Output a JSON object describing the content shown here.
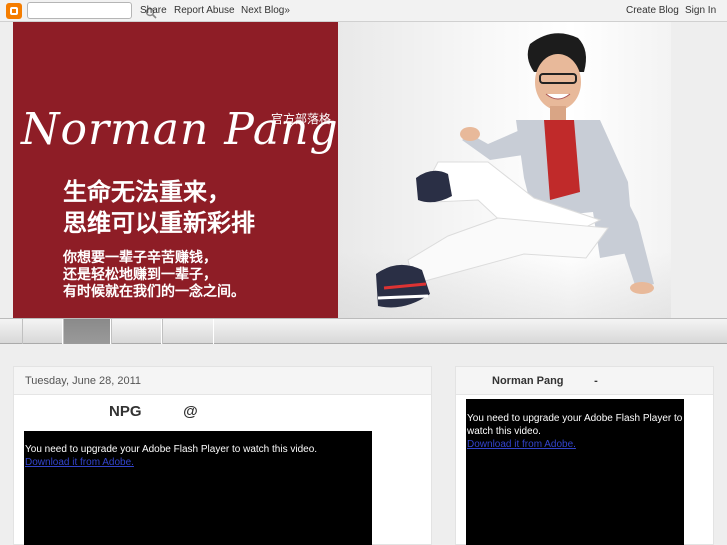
{
  "navbar": {
    "logo_icon": "blogger-icon",
    "search_placeholder": "",
    "search_icon": "search-icon",
    "share": "Share",
    "report_abuse": "Report Abuse",
    "next_blog": "Next Blog»",
    "create_blog": "Create Blog",
    "sign_in": "Sign In"
  },
  "header": {
    "name": "Norman Pang",
    "subtitle": "官方部落格",
    "slogan_line1": "生命无法重来，",
    "slogan_line2": "思维可以重新彩排",
    "slogan_line3": "你想要一辈子辛苦赚钱，",
    "slogan_line4": "还是轻松地赚到一辈子，",
    "slogan_line5": "有时候就在我们的一念之间。",
    "left_bg_color": "#8e1d26"
  },
  "main": {
    "date": "Tuesday, June 28, 2011",
    "post_title": "NPG          @",
    "flash_message": "You need to upgrade your Adobe Flash Player to watch this video.",
    "flash_link": "Download it from Adobe."
  },
  "sidebar": {
    "title": "Norman Pang          -",
    "flash_message": "You need to upgrade your Adobe Flash Player to watch this video.",
    "flash_link": "Download it from Adobe."
  }
}
